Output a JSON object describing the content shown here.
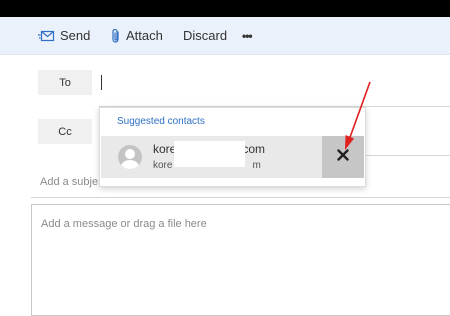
{
  "toolbar": {
    "send_label": "Send",
    "attach_label": "Attach",
    "discard_label": "Discard",
    "more_label": "•••",
    "send_icon": "envelope-icon",
    "attach_icon": "paperclip-icon",
    "more_icon": "ellipsis-icon"
  },
  "recipients": {
    "to_label": "To",
    "cc_label": "Cc",
    "to_value": "",
    "cc_value": ""
  },
  "suggestions": {
    "title": "Suggested contacts",
    "contacts": [
      {
        "name_start": "kore",
        "name_end": "com",
        "email_start": "kore",
        "email_end": "m",
        "avatar_icon": "person-icon",
        "remove_icon": "close-icon"
      }
    ]
  },
  "subject": {
    "placeholder": "Add a subje"
  },
  "message": {
    "placeholder": "Add a message or drag a file here"
  },
  "colors": {
    "accent": "#2f6fc5",
    "toolbar_bg": "#eaf1fb",
    "annotation_arrow": "#e0201f",
    "remove_button_bg": "#c6c6c6"
  }
}
